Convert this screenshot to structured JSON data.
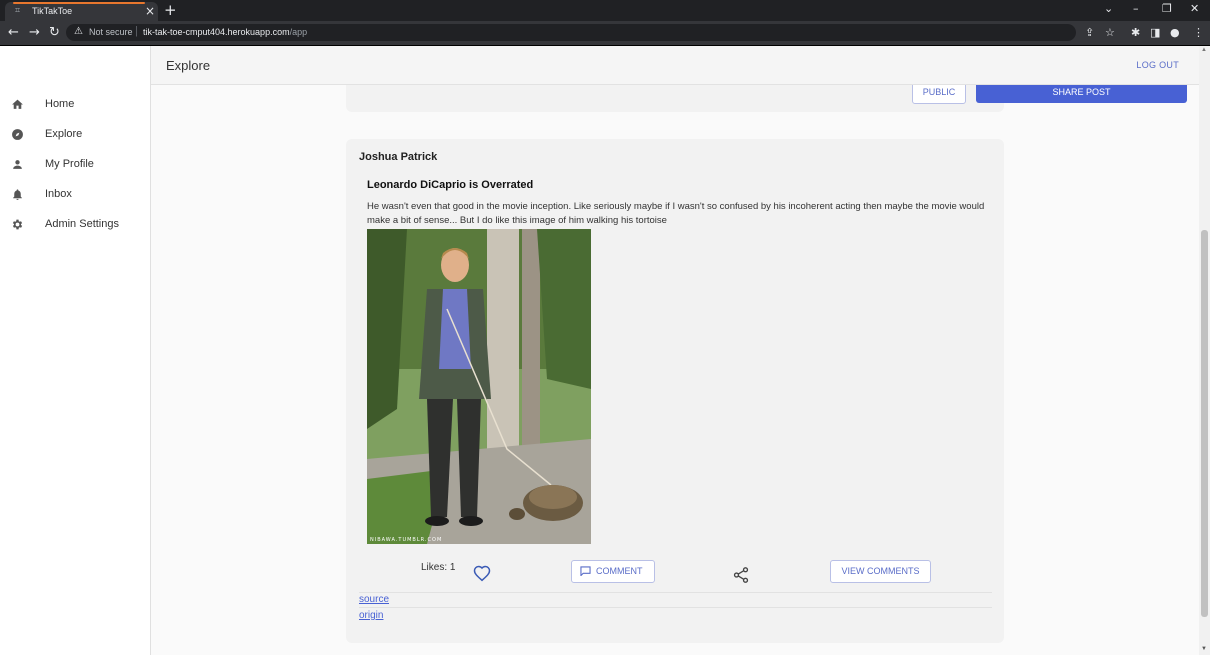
{
  "browser": {
    "tab_title": "TikTakToe",
    "not_secure_label": "Not secure",
    "url_host": "tik-tak-toe-cmput404.herokuapp.com",
    "url_path": "/app"
  },
  "header": {
    "page_title": "Explore",
    "logout_label": "LOG OUT"
  },
  "sidebar": {
    "items": [
      {
        "label": "Home",
        "icon": "home-icon"
      },
      {
        "label": "Explore",
        "icon": "compass-icon"
      },
      {
        "label": "My Profile",
        "icon": "person-icon"
      },
      {
        "label": "Inbox",
        "icon": "bell-icon"
      },
      {
        "label": "Admin Settings",
        "icon": "gear-icon"
      }
    ]
  },
  "composer": {
    "visibility_label": "PUBLIC",
    "share_label": "SHARE POST"
  },
  "post": {
    "author": "Joshua Patrick",
    "title": "Leonardo DiCaprio is Overrated",
    "body": "He wasn't even that good in the movie inception. Like seriously maybe if I wasn't so confused by his incoherent acting then maybe the movie would make a bit of sense... But I do like this image of him walking his tortoise",
    "image_watermark": "NIBAWA.TUMBLR.COM",
    "likes_label": "Likes: 1",
    "comment_label": "COMMENT",
    "view_comments_label": "VIEW COMMENTS",
    "source_link": "source",
    "origin_link": "origin"
  },
  "colors": {
    "accent": "#4861d4",
    "accent_text": "#5a6dc8"
  }
}
